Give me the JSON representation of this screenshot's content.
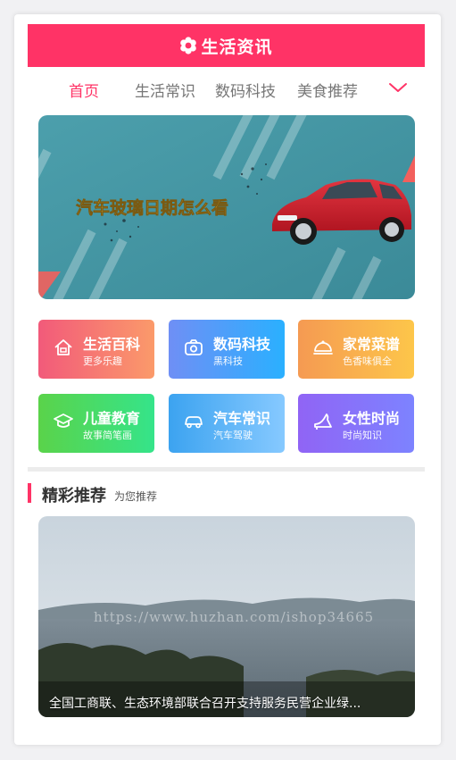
{
  "header": {
    "title": "生活资讯"
  },
  "nav": {
    "tabs": [
      {
        "label": "首页",
        "active": true
      },
      {
        "label": "生活常识",
        "active": false
      },
      {
        "label": "数码科技",
        "active": false
      },
      {
        "label": "美食推荐",
        "active": false
      }
    ],
    "more_icon": "chevron-down-icon"
  },
  "banner": {
    "headline": "汽车玻璃日期怎么看",
    "slide_count": 3,
    "active_slide": 1
  },
  "categories": [
    {
      "title": "生活百科",
      "subtitle": "更多乐趣",
      "icon": "house-icon",
      "colors": [
        "#f25a7a",
        "#fb9a6a"
      ]
    },
    {
      "title": "数码科技",
      "subtitle": "黑科技",
      "icon": "camera-icon",
      "colors": [
        "#6f8ff5",
        "#2ab0ff"
      ]
    },
    {
      "title": "家常菜谱",
      "subtitle": "色香味俱全",
      "icon": "dish-icon",
      "colors": [
        "#f59a52",
        "#fdc64a"
      ]
    },
    {
      "title": "儿童教育",
      "subtitle": "故事简笔画",
      "icon": "graduation-cap-icon",
      "colors": [
        "#5ad34a",
        "#35e48a"
      ]
    },
    {
      "title": "汽车常识",
      "subtitle": "汽车驾驶",
      "icon": "car-icon",
      "colors": [
        "#3ca3f0",
        "#86c9ff"
      ]
    },
    {
      "title": "女性时尚",
      "subtitle": "时尚知识",
      "icon": "high-heel-icon",
      "colors": [
        "#9064f5",
        "#7d83ff"
      ]
    }
  ],
  "section": {
    "title": "精彩推荐",
    "subtitle": "为您推荐"
  },
  "featured": {
    "caption": "全国工商联、生态环境部联合召开支持服务民营企业绿...",
    "watermark": "https://www.huzhan.com/ishop34665"
  },
  "colors": {
    "brand": "#ff3366",
    "active_tab": "#ff3366",
    "inactive_tab": "#777777"
  }
}
